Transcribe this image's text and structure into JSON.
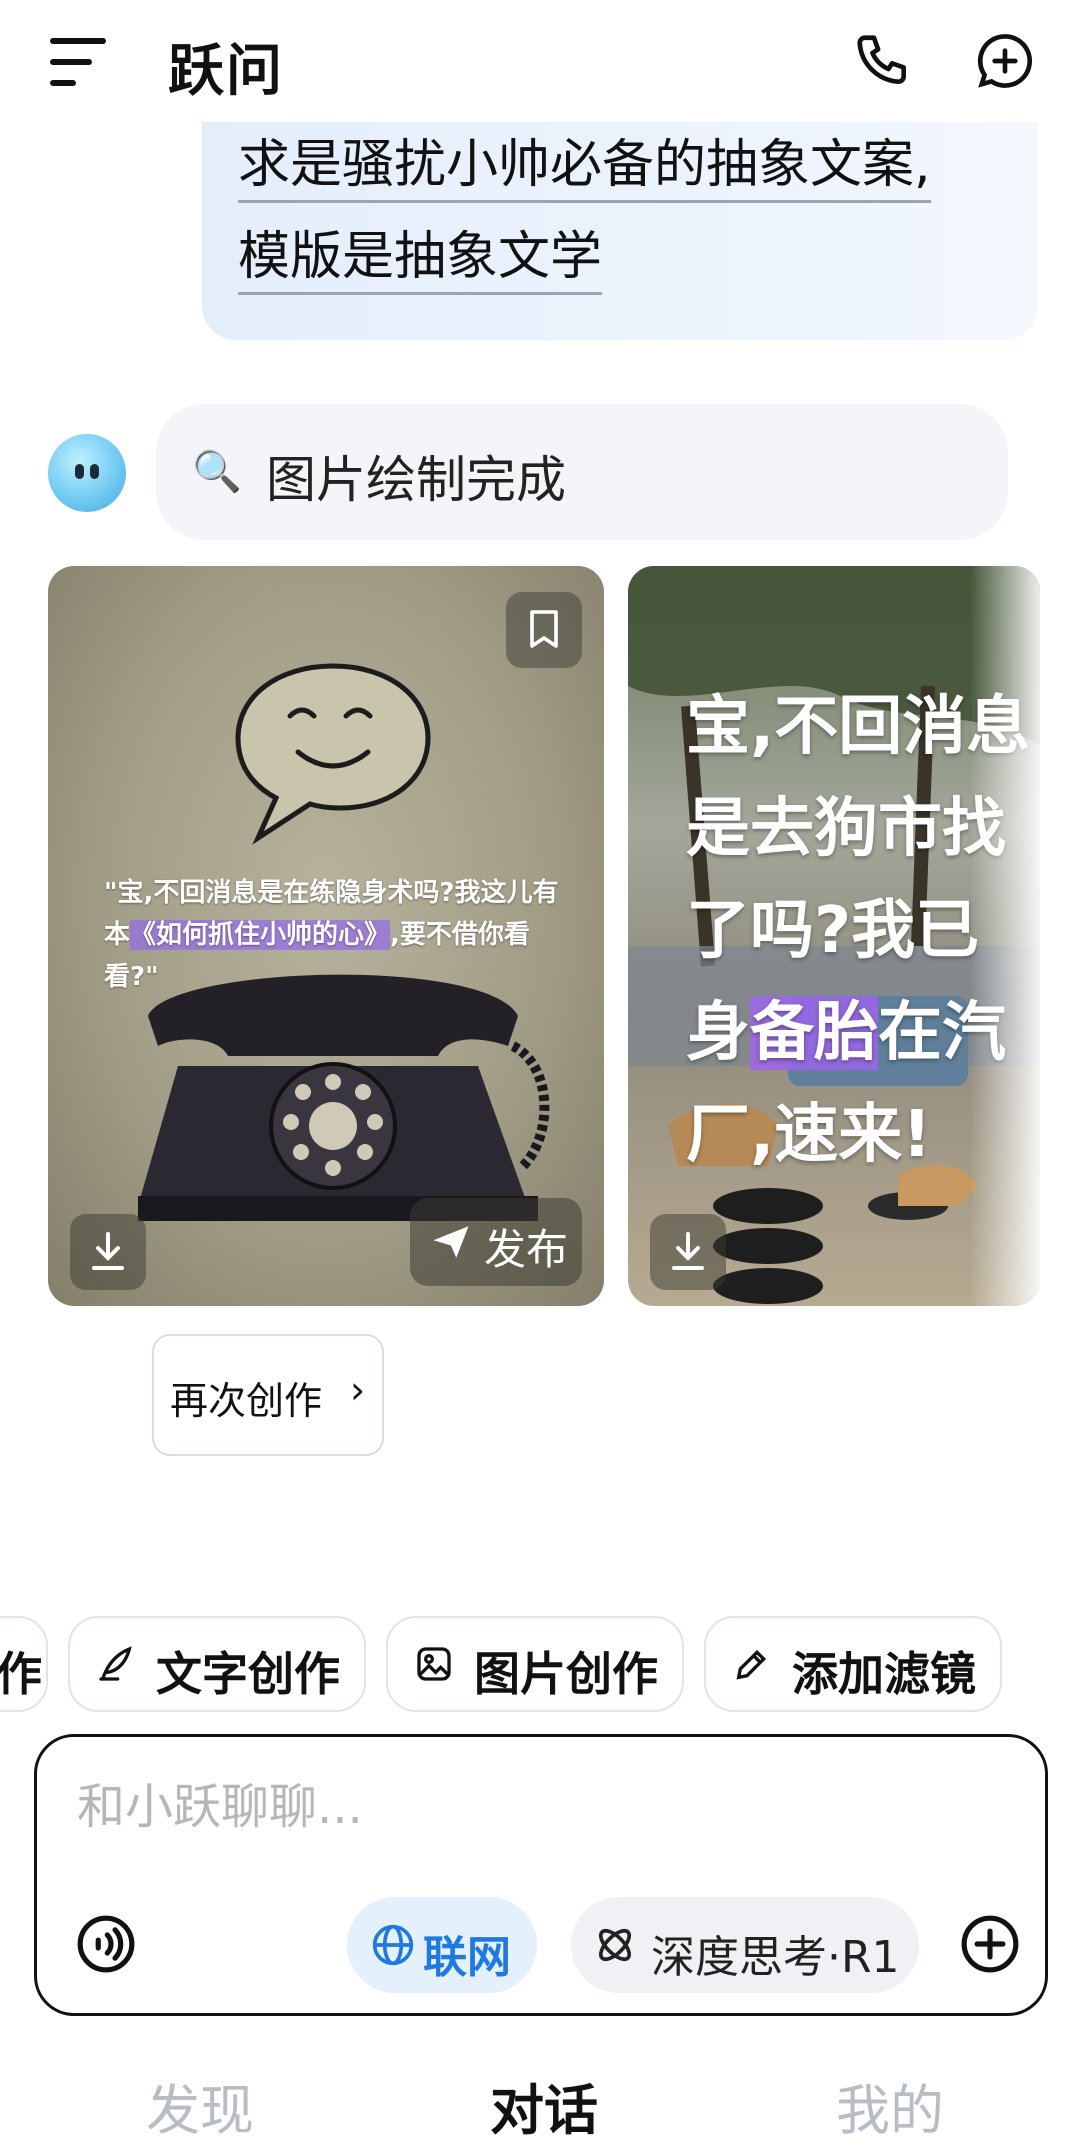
{
  "header": {
    "title": "跃问"
  },
  "user_message": {
    "line1": "求是骚扰小帅必备的抽象文案,",
    "line2": "模版是抽象文学"
  },
  "assistant": {
    "status_text": "图片绘制完成"
  },
  "cards": [
    {
      "caption_part1": "\"宝,不回消息是在练隐身术吗?我这儿有本",
      "caption_highlight": "《如何抓住小帅的心》",
      "caption_part2": ",要不借你看看?\"",
      "publish_label": "发布"
    },
    {
      "line1": "宝,不回消息",
      "line2": "是去狗市找",
      "line3": "了吗?我已",
      "line4_pre": "身",
      "line4_hl": "备胎",
      "line4_post": "在汽",
      "line5": "厂,速来!"
    }
  ],
  "recreate_label": "再次创作",
  "recreate_chevron": "›",
  "quick_actions": {
    "partial": "作",
    "items": [
      "文字创作",
      "图片创作",
      "添加滤镜"
    ]
  },
  "input": {
    "placeholder": "和小跃聊聊..."
  },
  "toggles": {
    "web_label": "联网",
    "deep_label": "深度思考·R1"
  },
  "nav": {
    "discover": "发现",
    "chat": "对话",
    "mine": "我的"
  },
  "colors": {
    "accent": "#1f7ae0",
    "nav_inactive": "#b8bcc4"
  }
}
